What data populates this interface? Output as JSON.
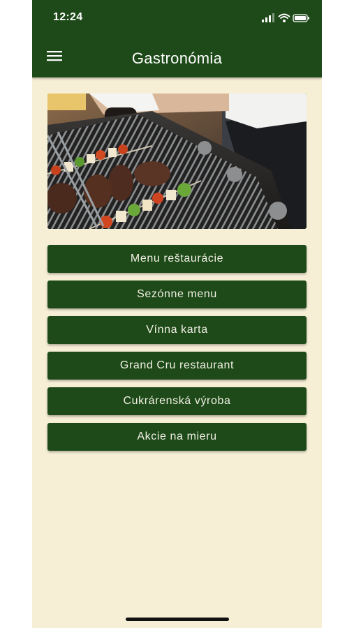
{
  "status_bar": {
    "time": "12:24",
    "icons": [
      "cellular-signal-icon",
      "wifi-icon",
      "battery-icon"
    ]
  },
  "header": {
    "title": "Gastronómia",
    "menu_icon": "hamburger-menu-icon",
    "background": "#1d4a18"
  },
  "hero_image": {
    "subject": "grilled-meat-and-vegetable-skewers-photo"
  },
  "menu_buttons": [
    {
      "label": "Menu reštaurácie"
    },
    {
      "label": "Sezónne menu"
    },
    {
      "label": "Vínna karta"
    },
    {
      "label": "Grand Cru restaurant"
    },
    {
      "label": "Cukrárenská výroba"
    },
    {
      "label": "Akcie na mieru"
    }
  ],
  "colors": {
    "brand_green": "#1d4a18",
    "page_background": "#f6efd6",
    "button_text": "#f3f0e6"
  }
}
